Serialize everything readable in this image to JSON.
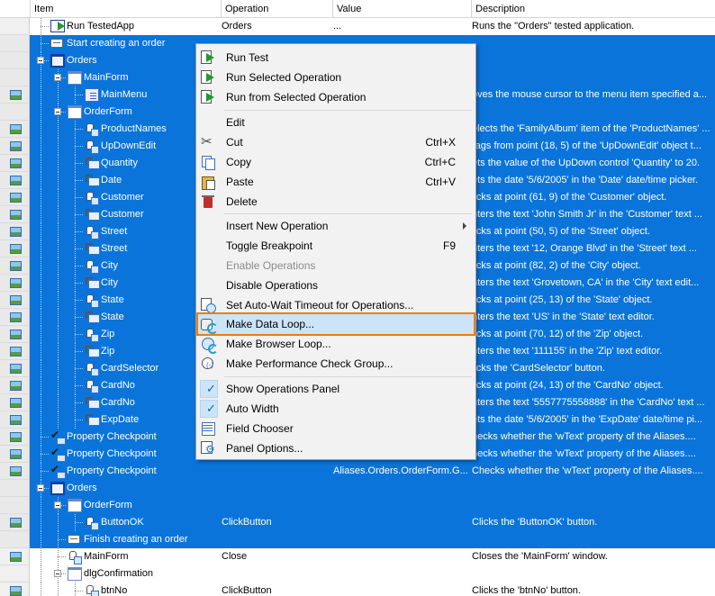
{
  "columns": {
    "item": "Item",
    "operation": "Operation",
    "value": "Value",
    "description": "Description"
  },
  "rows": [
    {
      "item": "Run TestedApp",
      "operation": "Orders",
      "value": "...",
      "description": "Runs the \"Orders\" tested application."
    },
    {
      "item": "Start creating an order",
      "operation": "",
      "value": "",
      "description": ""
    },
    {
      "item": "Orders",
      "operation": "",
      "value": "",
      "description": ""
    },
    {
      "item": "MainForm",
      "operation": "",
      "value": "",
      "description": ""
    },
    {
      "item": "MainMenu",
      "operation": "",
      "value": "",
      "description": "oves the mouse cursor to the menu item specified a..."
    },
    {
      "item": "OrderForm",
      "operation": "",
      "value": "",
      "description": ""
    },
    {
      "item": "ProductNames",
      "operation": "",
      "value": "",
      "description": "elects the 'FamilyAlbum' item of the 'ProductNames' ..."
    },
    {
      "item": "UpDownEdit",
      "operation": "",
      "value": "",
      "description": "rags from point (18, 5) of the 'UpDownEdit' object t..."
    },
    {
      "item": "Quantity",
      "operation": "",
      "value": "",
      "description": "ets the value of the UpDown control 'Quantity' to 20."
    },
    {
      "item": "Date",
      "operation": "",
      "value": "",
      "description": "ets the date '5/6/2005' in the 'Date' date/time picker."
    },
    {
      "item": "Customer",
      "operation": "",
      "value": "",
      "description": "licks at point (61, 9) of the 'Customer' object."
    },
    {
      "item": "Customer",
      "operation": "",
      "value": "",
      "description": "nters the text 'John Smith Jr' in the 'Customer' text ..."
    },
    {
      "item": "Street",
      "operation": "",
      "value": "",
      "description": "licks at point (50, 5) of the 'Street' object."
    },
    {
      "item": "Street",
      "operation": "",
      "value": "",
      "description": "nters the text '12, Orange Blvd' in the 'Street' text ..."
    },
    {
      "item": "City",
      "operation": "",
      "value": "",
      "description": "licks at point (82, 2) of the 'City' object."
    },
    {
      "item": "City",
      "operation": "",
      "value": "",
      "description": "nters the text 'Grovetown, CA' in the 'City' text edit..."
    },
    {
      "item": "State",
      "operation": "",
      "value": "",
      "description": "licks at point (25, 13) of the 'State' object."
    },
    {
      "item": "State",
      "operation": "",
      "value": "",
      "description": "nters the text 'US' in the 'State' text editor."
    },
    {
      "item": "Zip",
      "operation": "",
      "value": "",
      "description": "licks at point (70, 12) of the 'Zip' object."
    },
    {
      "item": "Zip",
      "operation": "",
      "value": "",
      "description": "nters the text '111155' in the 'Zip' text editor."
    },
    {
      "item": "CardSelector",
      "operation": "",
      "value": "",
      "description": "licks the 'CardSelector' button."
    },
    {
      "item": "CardNo",
      "operation": "",
      "value": "",
      "description": "licks at point (24, 13) of the 'CardNo' object."
    },
    {
      "item": "CardNo",
      "operation": "",
      "value": "",
      "description": "nters the text '5557775558888' in the 'CardNo' text ..."
    },
    {
      "item": "ExpDate",
      "operation": "",
      "value": "",
      "description": "ets the date '5/6/2005' in the 'ExpDate' date/time pi..."
    },
    {
      "item": "Property Checkpoint",
      "operation": "",
      "value": "",
      "description": "hecks whether the 'wText' property of the Aliases...."
    },
    {
      "item": "Property Checkpoint",
      "operation": "",
      "value": "",
      "description": "hecks whether the 'wText' property of the Aliases...."
    },
    {
      "item": "Property Checkpoint",
      "operation": "",
      "value": "Aliases.Orders.OrderForm.G...",
      "description": "Checks whether the 'wText' property of the Aliases...."
    },
    {
      "item": "Orders",
      "operation": "",
      "value": "",
      "description": ""
    },
    {
      "item": "OrderForm",
      "operation": "",
      "value": "",
      "description": ""
    },
    {
      "item": "ButtonOK",
      "operation": "ClickButton",
      "value": "",
      "description": "Clicks the 'ButtonOK' button."
    },
    {
      "item": "Finish creating an order",
      "operation": "",
      "value": "",
      "description": ""
    },
    {
      "item": "MainForm",
      "operation": "Close",
      "value": "",
      "description": "Closes the 'MainForm' window."
    },
    {
      "item": "dlgConfirmation",
      "operation": "",
      "value": "",
      "description": ""
    },
    {
      "item": "btnNo",
      "operation": "ClickButton",
      "value": "",
      "description": "Clicks the 'btnNo' button."
    }
  ],
  "menu": {
    "run_test": "Run Test",
    "run_selected": "Run Selected Operation",
    "run_from_selected": "Run from Selected Operation",
    "edit": "Edit",
    "cut": "Cut",
    "cut_key": "Ctrl+X",
    "copy": "Copy",
    "copy_key": "Ctrl+C",
    "paste": "Paste",
    "paste_key": "Ctrl+V",
    "delete": "Delete",
    "insert_new": "Insert New Operation",
    "toggle_bp": "Toggle Breakpoint",
    "toggle_bp_key": "F9",
    "enable_ops": "Enable Operations",
    "disable_ops": "Disable Operations",
    "auto_wait": "Set Auto-Wait Timeout for Operations...",
    "data_loop": "Make Data Loop...",
    "browser_loop": "Make Browser Loop...",
    "perf_group": "Make Performance Check Group...",
    "show_panel": "Show Operations Panel",
    "auto_width": "Auto Width",
    "field_chooser": "Field Chooser",
    "panel_options": "Panel Options..."
  },
  "colors": {
    "selection": "#0a74da",
    "highlight_box": "#ef7d00",
    "menu_hover": "#cce4f7"
  }
}
